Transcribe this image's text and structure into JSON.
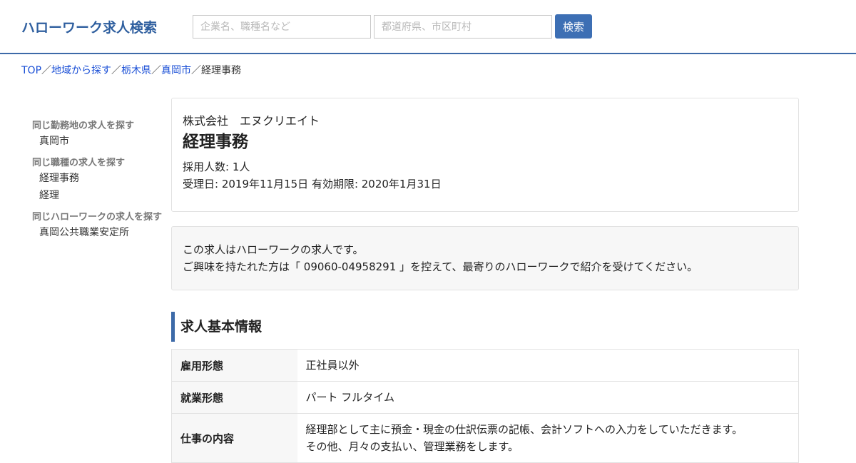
{
  "header": {
    "logo": "ハローワーク求人検索",
    "keyword_placeholder": "企業名、職種名など",
    "location_placeholder": "都道府県、市区町村",
    "search_button": "検索"
  },
  "breadcrumb": {
    "items": [
      "TOP",
      "地域から探す",
      "栃木県",
      "真岡市"
    ],
    "separator": "／",
    "current": "経理事務"
  },
  "sidebar": {
    "sections": [
      {
        "heading": "同じ勤務地の求人を探す",
        "links": [
          "真岡市"
        ]
      },
      {
        "heading": "同じ職種の求人を探す",
        "links": [
          "経理事務",
          "経理"
        ]
      },
      {
        "heading": "同じハローワークの求人を探す",
        "links": [
          "真岡公共職業安定所"
        ]
      }
    ]
  },
  "job": {
    "company": "株式会社　エヌクリエイト",
    "title": "経理事務",
    "hires_label": "採用人数: 1人",
    "dates_label": "受理日: 2019年11月15日 有効期限: 2020年1月31日"
  },
  "notice": {
    "line1": "この求人はハローワークの求人です。",
    "line2": "ご興味を持たれた方は「 09060-04958291 」を控えて、最寄りのハローワークで紹介を受けてください。"
  },
  "basic_info": {
    "title": "求人基本情報",
    "rows": [
      {
        "label": "雇用形態",
        "value": "正社員以外"
      },
      {
        "label": "就業形態",
        "value": "パート フルタイム"
      },
      {
        "label": "仕事の内容",
        "value_line1": "経理部として主に預金・現金の仕訳伝票の記帳、会計ソフトへの入力をしていただきます。",
        "value_line2": "その他、月々の支払い、管理業務をします。"
      }
    ]
  }
}
